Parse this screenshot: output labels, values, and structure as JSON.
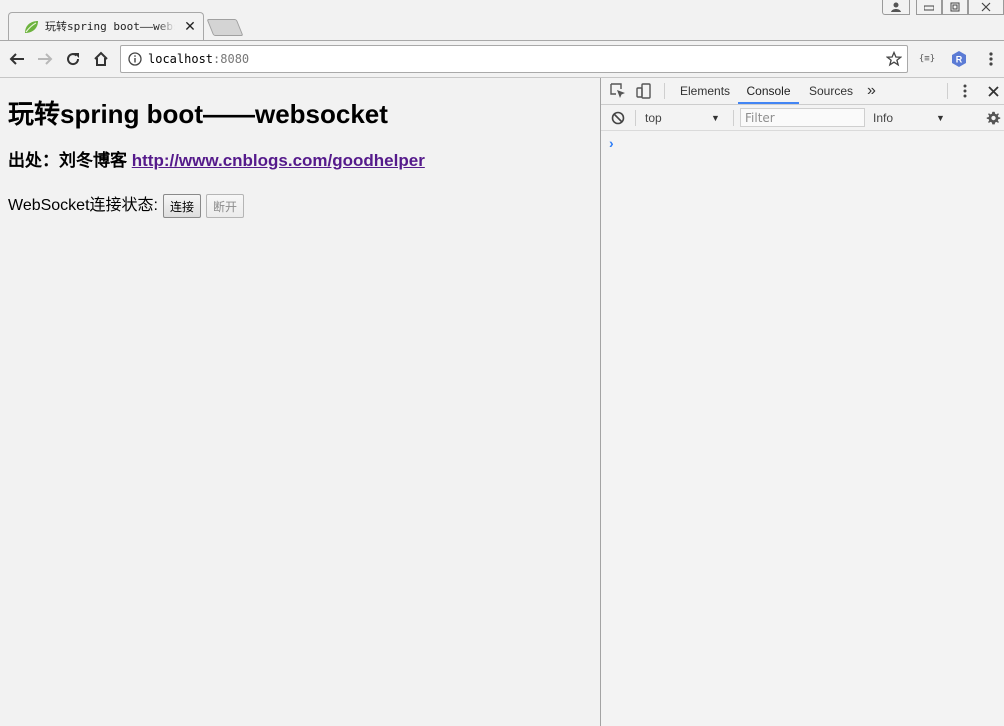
{
  "window": {
    "controls": [
      "minimize-icon",
      "maximize-icon",
      "close-icon"
    ]
  },
  "tab": {
    "title": "玩转spring boot——websocket",
    "close_glyph": "✕",
    "favicon": "spring-leaf-icon"
  },
  "toolbar": {
    "back": "back-arrow-icon",
    "forward": "forward-arrow-icon",
    "reload": "reload-icon",
    "home": "home-icon",
    "url_host": "localhost",
    "url_port": ":8080",
    "extensions": [
      "json-formatter-icon",
      "r-extension-icon"
    ],
    "menu": "more-vertical-icon",
    "extension_r_label": "R",
    "extension_json_label": "{≡}"
  },
  "page": {
    "heading": "玩转spring boot——websocket",
    "source_label": "出处：刘冬博客 ",
    "source_link": "http://www.cnblogs.com/goodhelper",
    "status_label": "WebSocket连接状态:",
    "connect_button": "连接",
    "disconnect_button": "断开"
  },
  "devtools": {
    "tabs": [
      "Elements",
      "Console",
      "Sources"
    ],
    "active_tab": "Console",
    "more_tabs_glyph": "»",
    "context_select": "top",
    "filter_placeholder": "Filter",
    "level_select": "Info",
    "prompt_glyph": "›",
    "accent_color": "#4285f4"
  }
}
